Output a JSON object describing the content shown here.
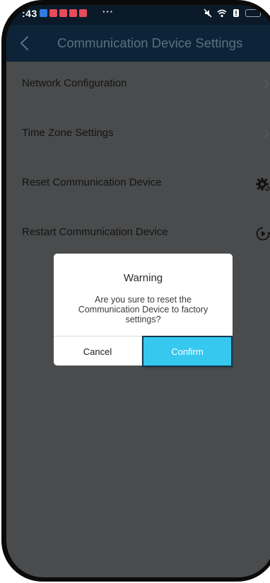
{
  "status_bar": {
    "time": ":43",
    "more": "···",
    "notif_colors": [
      "#2f7de1",
      "#e84b5a",
      "#e84b5a",
      "#e84b5a",
      "#e84b5a"
    ]
  },
  "header": {
    "title": "Communication Device Settings",
    "back_icon": "chevron-left-icon"
  },
  "settings": {
    "items": [
      {
        "label": "Network Configuration",
        "icon": "chevron-right-icon"
      },
      {
        "label": "Time Zone Settings",
        "icon": "chevron-right-icon"
      },
      {
        "label": "Reset Communication Device",
        "icon": "gear-reset-icon"
      },
      {
        "label": "Restart Communication Device",
        "icon": "restart-icon"
      }
    ]
  },
  "dialog": {
    "title": "Warning",
    "message": "Are you sure to reset the Communication Device to factory settings?",
    "cancel_label": "Cancel",
    "confirm_label": "Confirm"
  },
  "colors": {
    "header_bg": "#0d2438",
    "overlay_bg": "#4a4b4c",
    "confirm_bg": "#36c8ef"
  }
}
